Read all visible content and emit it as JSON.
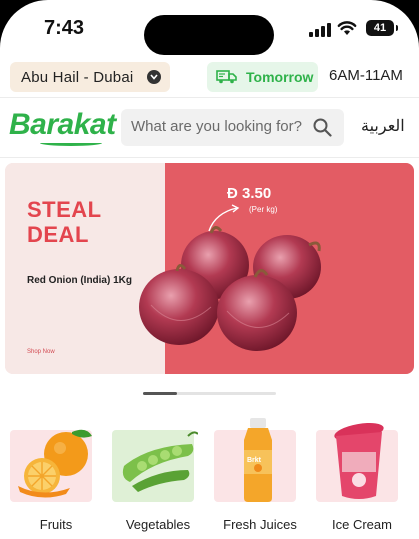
{
  "status_bar": {
    "time": "7:43",
    "battery": "41"
  },
  "location": {
    "label": "Abu Hail - Dubai"
  },
  "delivery": {
    "label": "Tomorrow",
    "slot": "6AM-11AM"
  },
  "header": {
    "logo": "Barakat",
    "language": "العربية"
  },
  "search": {
    "placeholder": "What are you looking for?"
  },
  "banner": {
    "headline_1": "STEAL",
    "headline_2": "DEAL",
    "product": "Red Onion (India) 1Kg",
    "cta": "Shop Now",
    "price": "Ð 3.50",
    "unit": "(Per kg)"
  },
  "carousel": {
    "slide_count_shown": 1,
    "active_fraction": 0.25
  },
  "categories": [
    {
      "label": "Fruits"
    },
    {
      "label": "Vegetables"
    },
    {
      "label": "Fresh Juices"
    },
    {
      "label": "Ice Cream"
    }
  ],
  "colors": {
    "brand_green": "#2fb24a",
    "banner_red": "#e35c64",
    "headline_red": "#e3454e"
  },
  "icons": [
    "chevron-down-icon",
    "truck-icon",
    "search-icon",
    "signal-icon",
    "wifi-icon",
    "battery-icon"
  ]
}
